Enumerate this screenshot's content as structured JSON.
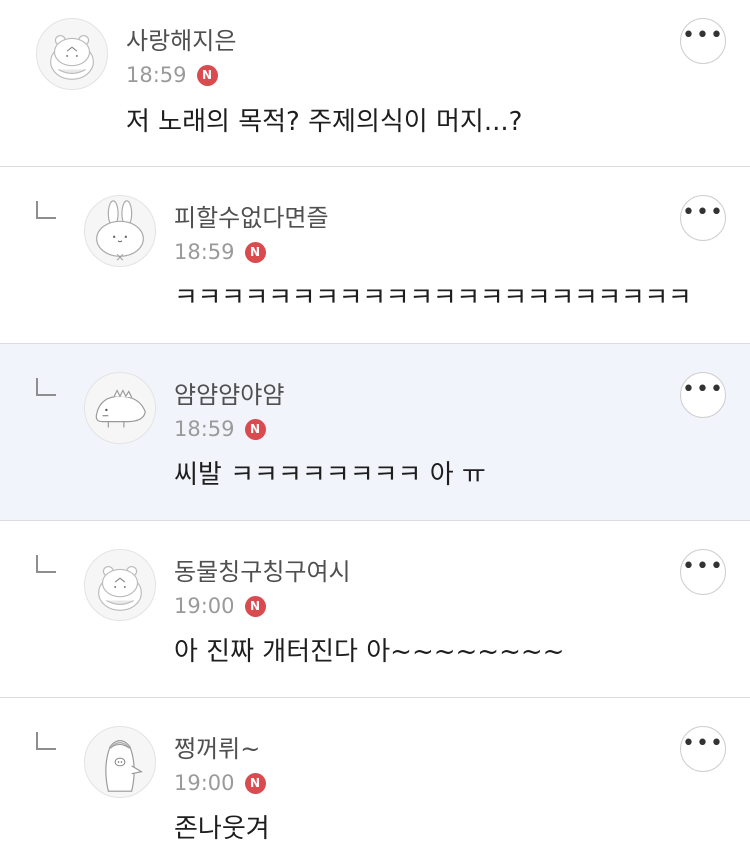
{
  "comments": [
    {
      "nickname": "사랑해지은",
      "time": "18:59",
      "badge": "N",
      "text": "저 노래의 목적? 주제의식이 머지...?",
      "avatar_icon": "hamster-avatar-icon",
      "reply": false
    },
    {
      "nickname": "피할수없다면즐",
      "time": "18:59",
      "badge": "N",
      "text": "ㅋㅋㅋㅋㅋㅋㅋㅋㅋㅋㅋㅋㅋㅋㅋㅋㅋㅋㅋㅋㅋㅋ",
      "avatar_icon": "rabbit-avatar-icon",
      "reply": true
    },
    {
      "nickname": "얌얌얌야얌",
      "time": "18:59",
      "badge": "N",
      "text": "씨발 ㅋㅋㅋㅋㅋㅋㅋㅋ 아 ㅠ",
      "avatar_icon": "dinosaur-avatar-icon",
      "reply": true
    },
    {
      "nickname": "동물칭구칭구여시",
      "time": "19:00",
      "badge": "N",
      "text": "아 진짜 개터진다 아~~~~~~~~",
      "avatar_icon": "hamster-avatar-icon",
      "reply": true
    },
    {
      "nickname": "쩡꺼뤼~",
      "time": "19:00",
      "badge": "N",
      "text": "존나웃겨",
      "avatar_icon": "penguin-avatar-icon",
      "reply": true
    }
  ],
  "more_label": "•••",
  "colors": {
    "badge": "#d94b4f",
    "highlight_bg": "#f1f5fb",
    "divider": "#dcdcdc"
  }
}
